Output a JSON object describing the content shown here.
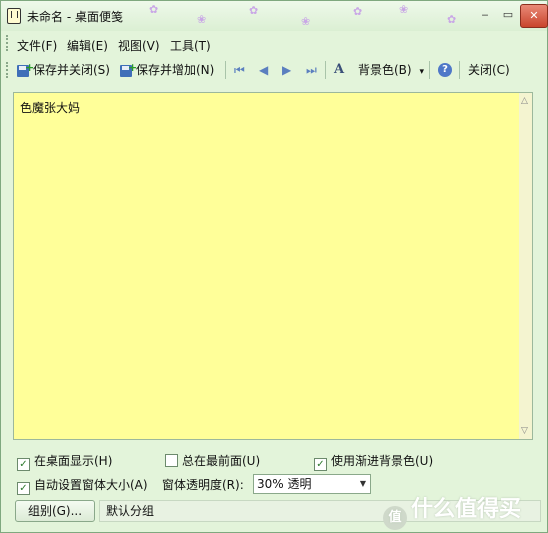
{
  "window": {
    "title": "未命名 - 桌面便笺",
    "controls": {
      "minimize": "‒",
      "maximize": "▭",
      "close": "✕"
    }
  },
  "menubar": {
    "items": [
      "文件(F)",
      "编辑(E)",
      "视图(V)",
      "工具(T)"
    ]
  },
  "toolbar": {
    "save_close": "保存并关闭(S)",
    "save_add": "保存并增加(N)",
    "nav": {
      "first": "⏮",
      "prev": "◀",
      "next": "▶",
      "last": "⏭"
    },
    "font_icon": "A",
    "bgcolor": "背景色(B)",
    "bgcolor_arrow": "▾",
    "help_icon": "?",
    "close": "关闭(C)"
  },
  "editor": {
    "text": "色魔张大妈"
  },
  "options": {
    "show_on_desktop": {
      "label": "在桌面显示(H)",
      "checked": true
    },
    "always_on_top": {
      "label": "总在最前面(U)",
      "checked": false
    },
    "gradient_bg": {
      "label": "使用渐进背景色(U)",
      "checked": true
    },
    "auto_size": {
      "label": "自动设置窗体大小(A)",
      "checked": true
    },
    "opacity_label": "窗体透明度(R):",
    "opacity_value": "30% 透明"
  },
  "group": {
    "button": "组别(G)...",
    "value": "默认分组"
  },
  "watermark": {
    "logo": "值",
    "text": "什么值得买"
  }
}
